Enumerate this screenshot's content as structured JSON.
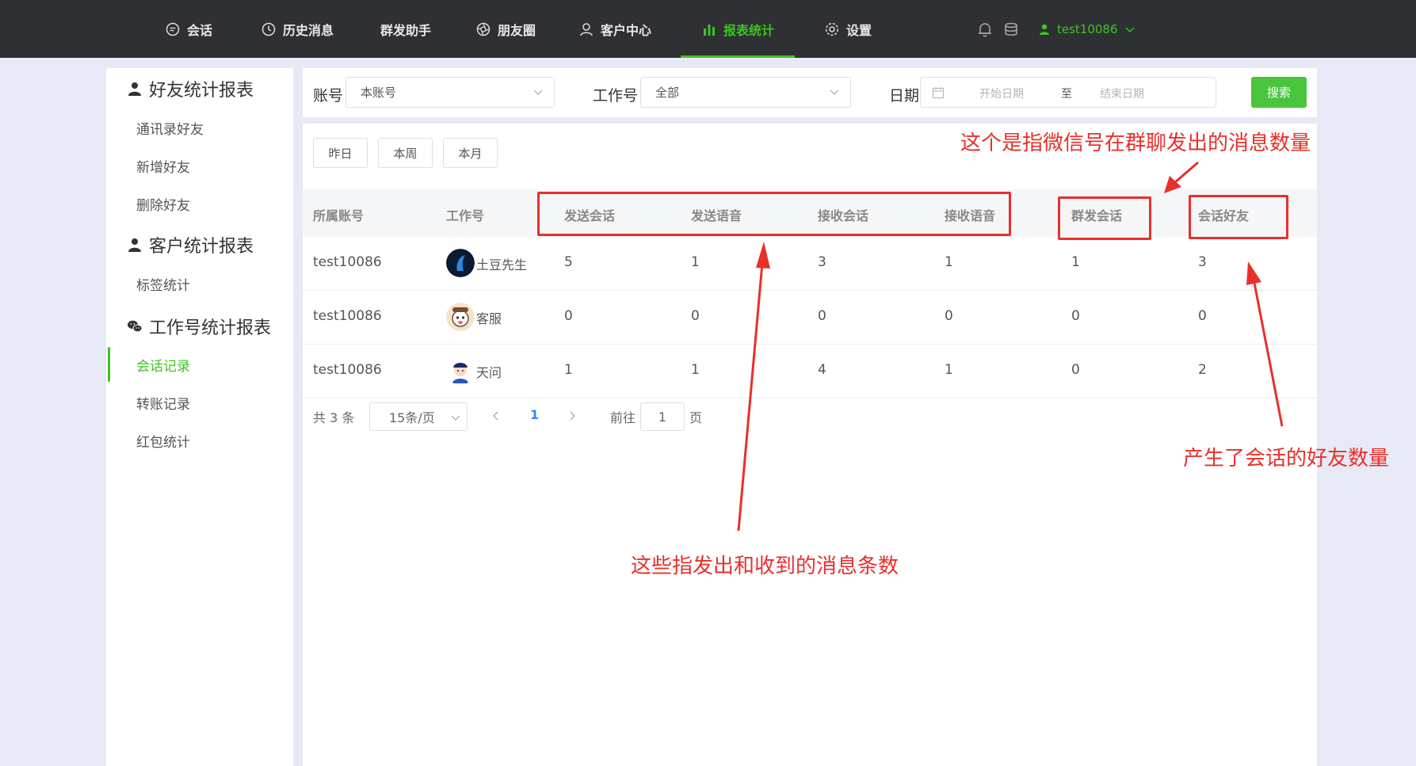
{
  "nav": {
    "items": [
      {
        "label": "会话",
        "icon": "chat-bubble-icon"
      },
      {
        "label": "历史消息",
        "icon": "clock-icon"
      },
      {
        "label": "群发助手",
        "icon": ""
      },
      {
        "label": "朋友圈",
        "icon": "aperture-icon"
      },
      {
        "label": "客户中心",
        "icon": "person-icon"
      },
      {
        "label": "报表统计",
        "icon": "bar-chart-icon",
        "active": true
      },
      {
        "label": "设置",
        "icon": "gear-icon"
      }
    ],
    "user": "test10086",
    "accent": "#3cc51f"
  },
  "sidebar": {
    "group1": "好友统计报表",
    "group1_items": [
      "通讯录好友",
      "新增好友",
      "删除好友"
    ],
    "group2": "客户统计报表",
    "group2_items": [
      "标签统计"
    ],
    "group3": "工作号统计报表",
    "group3_items": [
      "会话记录",
      "转账记录",
      "红包统计"
    ],
    "active": "会话记录"
  },
  "filter": {
    "account_label": "账号",
    "account_value": "本账号",
    "workno_label": "工作号",
    "workno_value": "全部",
    "date_label": "日期",
    "start_placeholder": "开始日期",
    "separator": "至",
    "end_placeholder": "结束日期",
    "search_label": "搜索"
  },
  "quick": [
    "昨日",
    "本周",
    "本月"
  ],
  "table": {
    "headers": [
      "所属账号",
      "工作号",
      "发送会话",
      "发送语音",
      "接收会话",
      "接收语音",
      "群发会话",
      "会话好友"
    ],
    "rows": [
      {
        "account": "test10086",
        "workno": "土豆先生",
        "c1": "5",
        "c2": "1",
        "c3": "3",
        "c4": "1",
        "c5": "1",
        "c6": "3"
      },
      {
        "account": "test10086",
        "workno": "客服",
        "c1": "0",
        "c2": "0",
        "c3": "0",
        "c4": "0",
        "c5": "0",
        "c6": "0"
      },
      {
        "account": "test10086",
        "workno": "天问",
        "c1": "1",
        "c2": "1",
        "c3": "4",
        "c4": "1",
        "c5": "0",
        "c6": "2"
      }
    ]
  },
  "pager": {
    "total": "共 3 条",
    "size": "15条/页",
    "current": "1",
    "goto_label": "前往",
    "goto_value": "1",
    "page_suffix": "页"
  },
  "annotations": {
    "group_msgs": "这个是指微信号在群聊发出的消息数量",
    "friends": "产生了会话的好友数量",
    "msgs": "这些指发出和收到的消息条数",
    "color": "#e8302a"
  }
}
